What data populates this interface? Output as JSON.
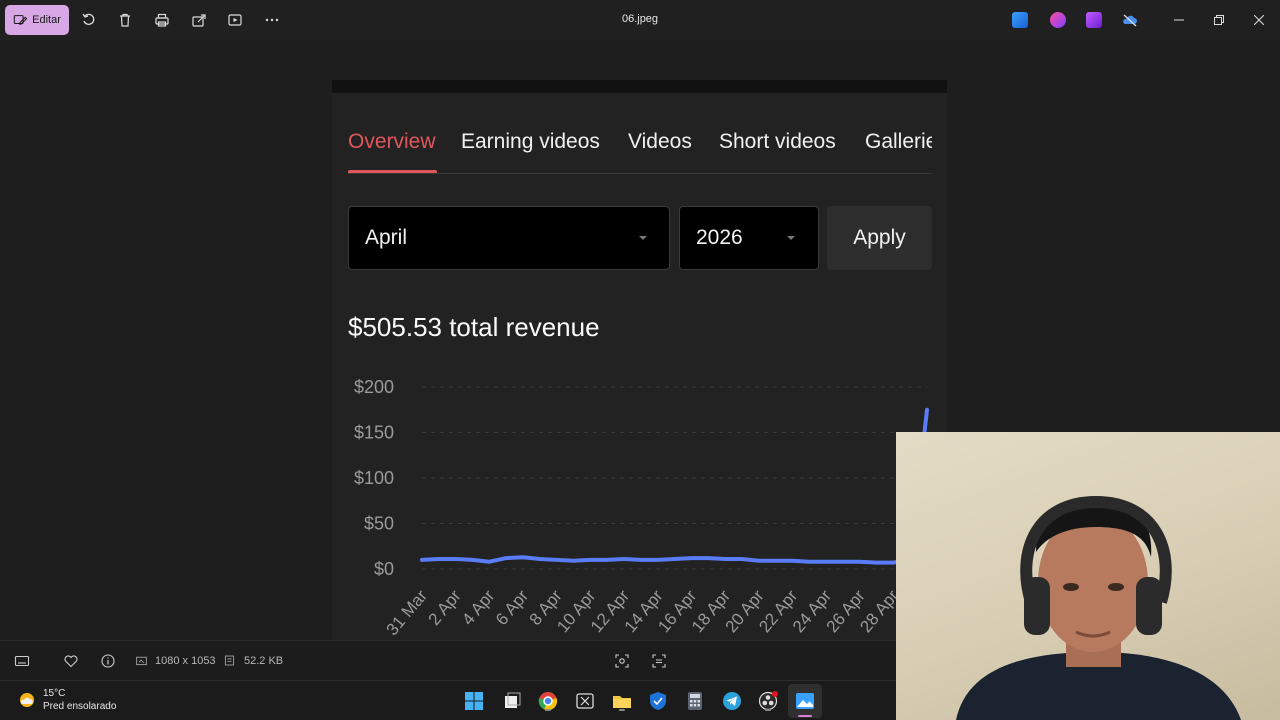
{
  "titlebar": {
    "edit_label": "Editar",
    "file_name": "06.jpeg"
  },
  "page": {
    "tabs": [
      {
        "label": "Overview",
        "active": true
      },
      {
        "label": "Earning videos",
        "active": false
      },
      {
        "label": "Videos",
        "active": false
      },
      {
        "label": "Short videos",
        "active": false
      },
      {
        "label": "Galleries",
        "active": false
      }
    ],
    "month_select": {
      "value": "April"
    },
    "year_select": {
      "value": "2026"
    },
    "apply_label": "Apply",
    "total_revenue": "$505.53 total revenue"
  },
  "chart_data": {
    "type": "line",
    "ylim": [
      0,
      200
    ],
    "y_ticks": [
      "$200",
      "$150",
      "$100",
      "$50",
      "$0"
    ],
    "y_tick_values": [
      200,
      150,
      100,
      50,
      0
    ],
    "x_ticks": [
      "31 Mar",
      "2 Apr",
      "4 Apr",
      "6 Apr",
      "8 Apr",
      "10 Apr",
      "12 Apr",
      "14 Apr",
      "16 Apr",
      "18 Apr",
      "20 Apr",
      "22 Apr",
      "24 Apr",
      "26 Apr",
      "28 Apr"
    ],
    "x": [
      "31 Mar",
      "1 Apr",
      "2 Apr",
      "3 Apr",
      "4 Apr",
      "5 Apr",
      "6 Apr",
      "7 Apr",
      "8 Apr",
      "9 Apr",
      "10 Apr",
      "11 Apr",
      "12 Apr",
      "13 Apr",
      "14 Apr",
      "15 Apr",
      "16 Apr",
      "17 Apr",
      "18 Apr",
      "19 Apr",
      "20 Apr",
      "21 Apr",
      "22 Apr",
      "23 Apr",
      "24 Apr",
      "25 Apr",
      "26 Apr",
      "27 Apr",
      "28 Apr",
      "29 Apr",
      "30 Apr"
    ],
    "values": [
      10,
      11,
      11,
      10,
      8,
      12,
      13,
      11,
      10,
      9,
      10,
      10,
      11,
      10,
      10,
      11,
      12,
      12,
      11,
      11,
      9,
      9,
      9,
      8,
      8,
      8,
      8,
      7,
      7,
      10,
      175
    ],
    "color": "#5b7cf7",
    "grid": true
  },
  "statusbar": {
    "dimensions": "1080 x 1053",
    "file_size": "52.2 KB"
  },
  "taskbar": {
    "temperature": "15°C",
    "weather": "Pred ensolarado"
  },
  "colors": {
    "accent": "#e0575b",
    "edit_button": "#d8a8e6",
    "line": "#5b7cf7"
  }
}
